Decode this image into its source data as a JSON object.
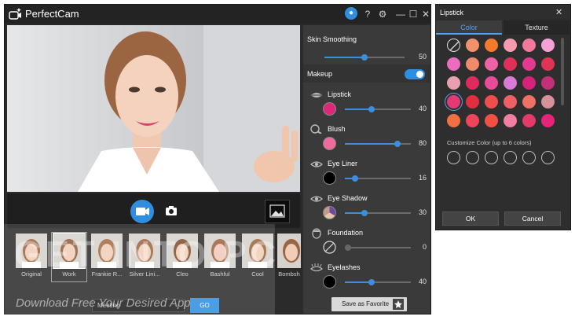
{
  "app": {
    "title": "PerfectCam"
  },
  "titlebar": {
    "icons": [
      "notification-icon",
      "help-icon",
      "settings-icon",
      "minimize-icon",
      "maximize-icon",
      "close-icon"
    ],
    "help_label": "?",
    "gear_label": "⚙",
    "min_label": "—",
    "max_label": "☐",
    "close_label": "✕"
  },
  "effects": [
    {
      "label": "Original"
    },
    {
      "label": "Work",
      "selected": true
    },
    {
      "label": "Frankie R..."
    },
    {
      "label": "Silver Lini..."
    },
    {
      "label": "Cleo"
    },
    {
      "label": "Bashful"
    },
    {
      "label": "Cool"
    },
    {
      "label": "Bombsh"
    }
  ],
  "bottom": {
    "meeting_label": "Meeting",
    "go_label": "GO"
  },
  "panel": {
    "skin_smoothing": {
      "label": "Skin Smoothing",
      "value": 50
    },
    "makeup": {
      "label": "Makeup",
      "enabled": true
    },
    "features": [
      {
        "label": "Lipstick",
        "value": 40,
        "swatch": "#e0257a",
        "icon": "lips-icon"
      },
      {
        "label": "Blush",
        "value": 80,
        "swatch": "#f06aa0",
        "icon": "blush-brush-icon"
      },
      {
        "label": "Eye Liner",
        "value": 16,
        "swatch": "#000000",
        "icon": "eye-icon"
      },
      {
        "label": "Eye Shadow",
        "value": 30,
        "swatch": "#c5a89a",
        "icon": "eye-icon"
      },
      {
        "label": "Foundation",
        "value": 0,
        "swatch": "none",
        "icon": "face-icon"
      },
      {
        "label": "Eyelashes",
        "value": 40,
        "swatch": "#000000",
        "icon": "eyelash-icon"
      }
    ],
    "save_favorite_label": "Save as Favorite"
  },
  "lipstick_window": {
    "title": "Lipstick",
    "close_label": "✕",
    "tabs": [
      {
        "label": "Color",
        "active": true
      },
      {
        "label": "Texture",
        "active": false
      }
    ],
    "colors": [
      [
        "none",
        "#f3926a",
        "#f47a2c",
        "#f59ab0",
        "#f2789c",
        "#f7a0d6"
      ],
      [
        "#ee6cc0",
        "#f08a6c",
        "#ee62a6",
        "#e0305a",
        "#e43a8e",
        "#e13454"
      ],
      [
        "#e8a0b0",
        "#e02a5c",
        "#e84c98",
        "#d87ad8",
        "#d4237a",
        "#c43078"
      ],
      [
        "#e43a74",
        "#e22e3e",
        "#f04e4c",
        "#ef5f66",
        "#ef7064",
        "#d8909a"
      ],
      [
        "#f17042",
        "#f0445a",
        "#f25044",
        "#f27ea0",
        "#e33a6a",
        "#e8237a"
      ]
    ],
    "selected_color": [
      3,
      0
    ],
    "customize_label": "Customize Color (up to 6 colors)",
    "ok_label": "OK",
    "cancel_label": "Cancel"
  },
  "watermark": {
    "big": "GET INTO PC",
    "small": "Download Free Your Desired App"
  }
}
